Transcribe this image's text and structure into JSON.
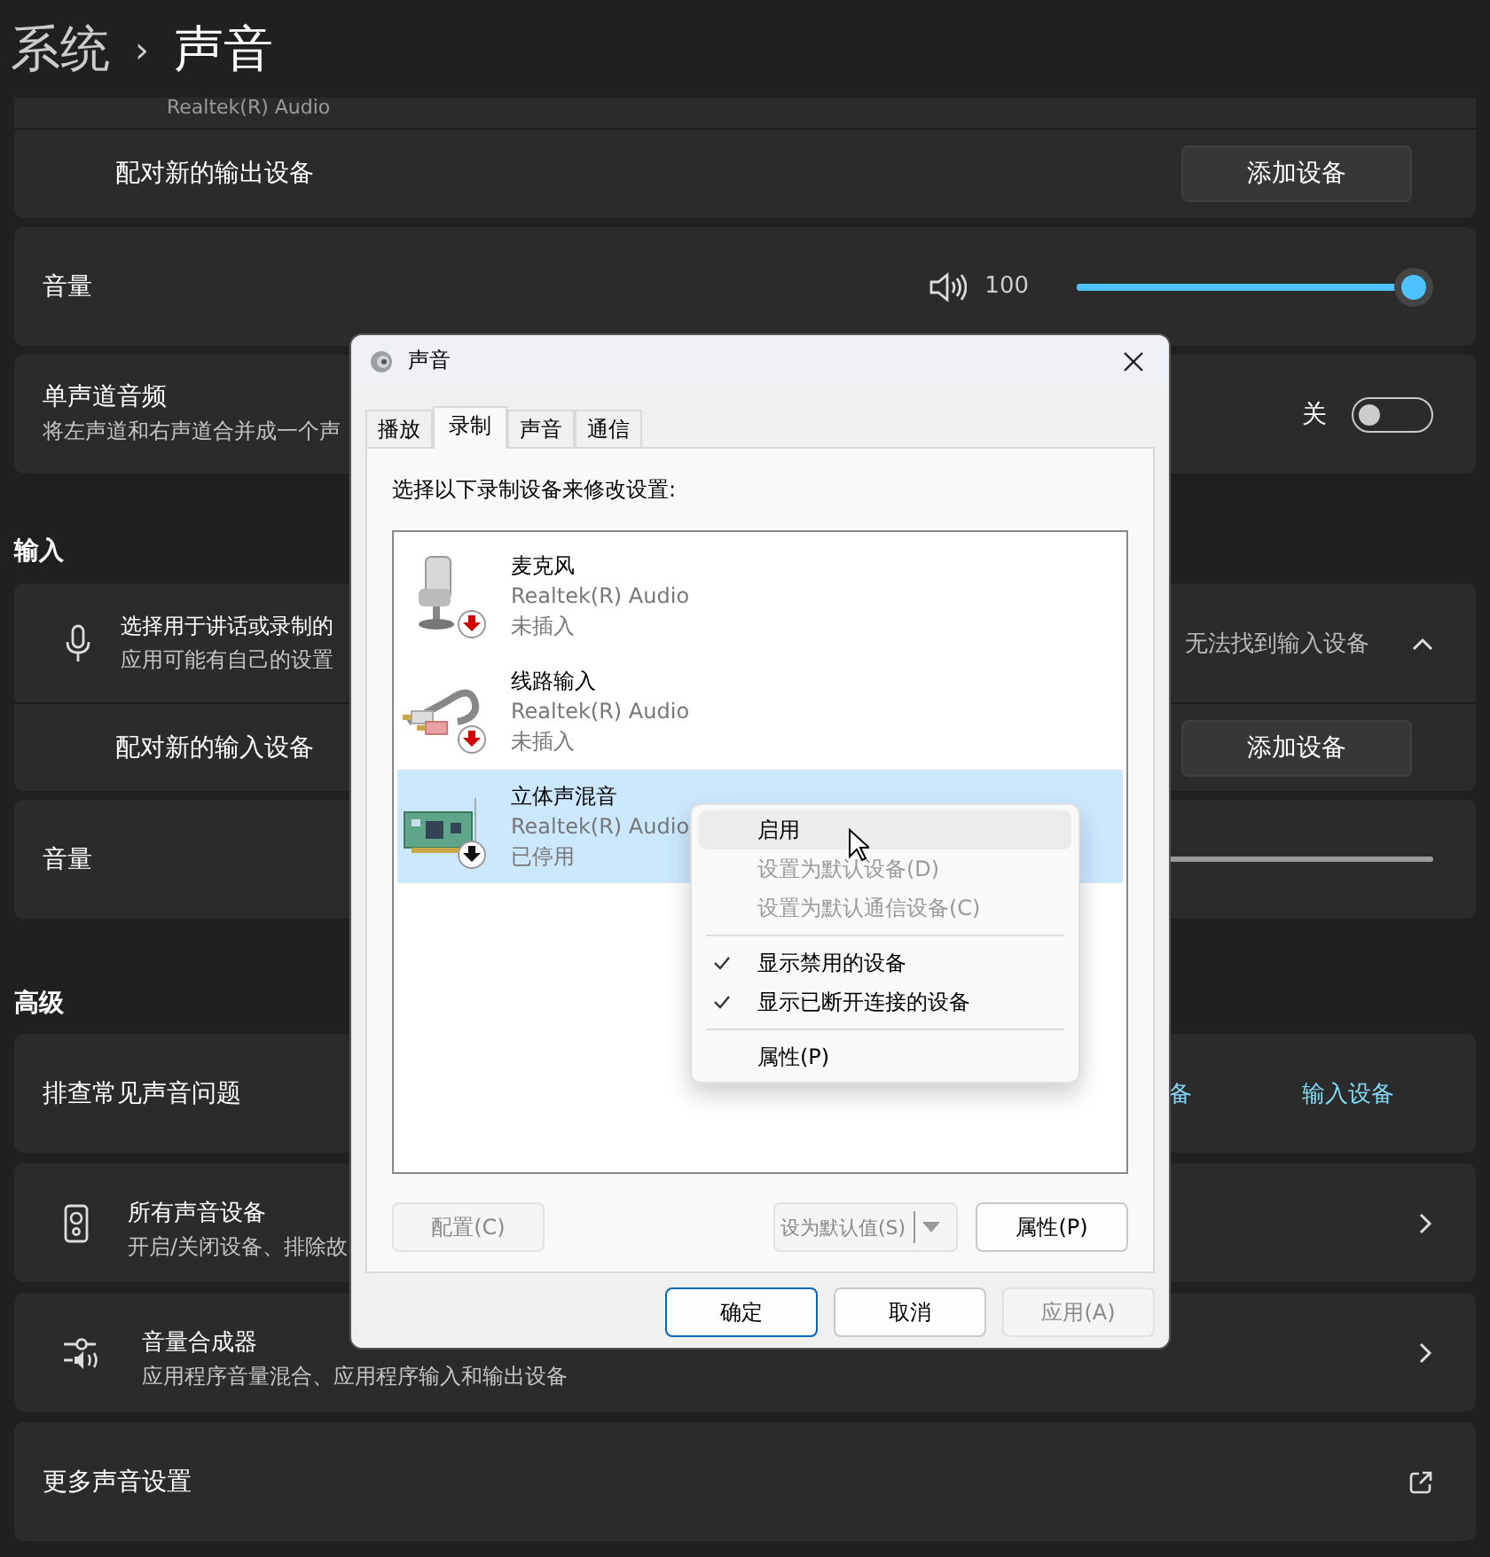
{
  "breadcrumb": {
    "parent": "系统",
    "separator": "›",
    "current": "声音"
  },
  "output": {
    "driver": "Realtek(R) Audio",
    "pair_label": "配对新的输出设备",
    "add_button": "添加设备"
  },
  "volume": {
    "label": "音量",
    "reading": "100",
    "level": 1
  },
  "mono": {
    "title": "单声道音频",
    "description": "将左声道和右声道合并成一个声",
    "state_label": "关",
    "on": false
  },
  "input_section": "输入",
  "input": {
    "title": "选择用于讲话或录制的",
    "description": "应用可能有自己的设置",
    "status": "无法找到输入设备",
    "expanded": true,
    "pair_label": "配对新的输入设备",
    "add_button": "添加设备"
  },
  "input_volume": {
    "label": "音量",
    "level": 0
  },
  "advanced_section": "高级",
  "advanced": [
    {
      "kind": "links",
      "title": "排查常见声音问题",
      "links": [
        "备",
        "输入设备"
      ]
    },
    {
      "kind": "nav",
      "title": "所有声音设备",
      "description": "开启/关闭设备、排除故"
    },
    {
      "kind": "nav",
      "title": "音量合成器",
      "description": "应用程序音量混合、应用程序输入和输出设备"
    },
    {
      "kind": "external",
      "title": "更多声音设置"
    }
  ],
  "dialog": {
    "title": "声音",
    "tabs": [
      {
        "label": "播放",
        "selected": false
      },
      {
        "label": "录制",
        "selected": true
      },
      {
        "label": "声音",
        "selected": false
      },
      {
        "label": "通信",
        "selected": false
      }
    ],
    "prompt": "选择以下录制设备来修改设置:",
    "devices": [
      {
        "kind": "microphone",
        "name": "麦克风",
        "driver": "Realtek(R) Audio",
        "status": "未插入",
        "disabled": false,
        "selected": false
      },
      {
        "kind": "line",
        "name": "线路输入",
        "driver": "Realtek(R) Audio",
        "status": "未插入",
        "disabled": false,
        "selected": false
      },
      {
        "kind": "card",
        "name": "立体声混音",
        "driver": "Realtek(R) Audio",
        "status": "已停用",
        "disabled": true,
        "selected": true
      }
    ],
    "configure": {
      "label": "配置(C)",
      "disabled": true
    },
    "set_default": {
      "label": "设为默认值(S)",
      "disabled": true
    },
    "properties": {
      "label": "属性(P)",
      "disabled": false
    },
    "footer": [
      {
        "label": "确定",
        "default": true,
        "disabled": false
      },
      {
        "label": "取消",
        "default": false,
        "disabled": false
      },
      {
        "label": "应用(A)",
        "default": false,
        "disabled": true
      }
    ],
    "context_menu": [
      {
        "kind": "item",
        "label": "启用",
        "hovered": true,
        "disabled": false,
        "checked": false
      },
      {
        "kind": "item",
        "label": "设置为默认设备(D)",
        "hovered": false,
        "disabled": true,
        "checked": false
      },
      {
        "kind": "item",
        "label": "设置为默认通信设备(C)",
        "hovered": false,
        "disabled": true,
        "checked": false
      },
      {
        "kind": "separator"
      },
      {
        "kind": "item",
        "label": "显示禁用的设备",
        "hovered": false,
        "disabled": false,
        "checked": true
      },
      {
        "kind": "item",
        "label": "显示已断开连接的设备",
        "hovered": false,
        "disabled": false,
        "checked": true
      },
      {
        "kind": "separator"
      },
      {
        "kind": "item",
        "label": "属性(P)",
        "hovered": false,
        "disabled": false,
        "checked": false
      }
    ]
  }
}
